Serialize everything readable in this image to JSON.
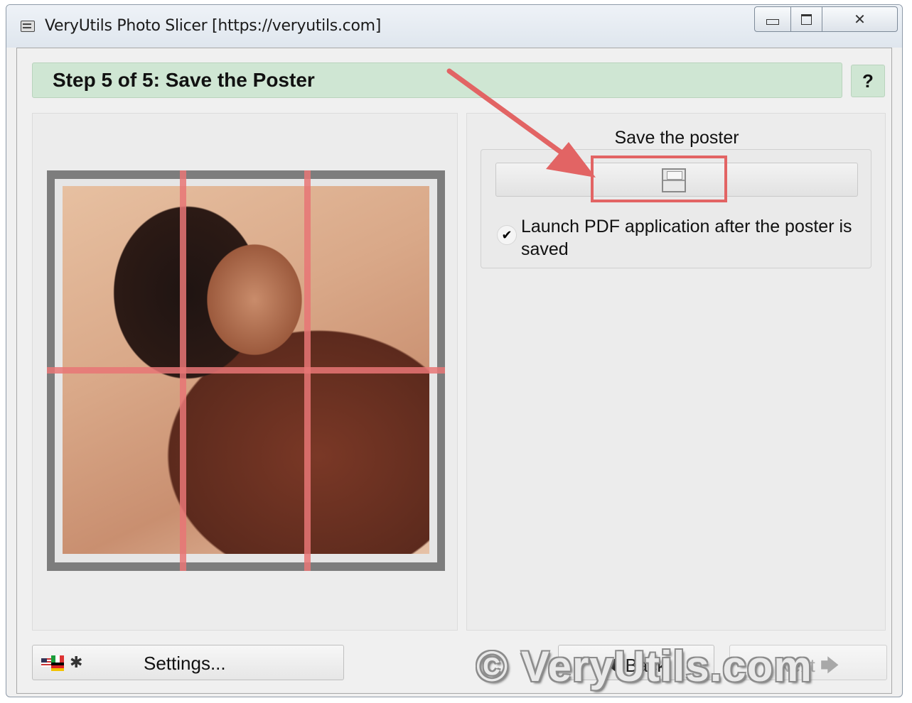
{
  "window": {
    "title": "VeryUtils Photo Slicer [https://veryutils.com]"
  },
  "header": {
    "step_title": "Step 5 of 5: Save the Poster",
    "help_label": "?"
  },
  "save_panel": {
    "label": "Save the poster",
    "launch_checkbox_checked": true,
    "checkmark": "✔",
    "launch_label": "Launch PDF application after the poster is saved"
  },
  "footer": {
    "settings_label": "Settings...",
    "back_label": "Back",
    "next_label": "Next",
    "back_arrow": "🡄",
    "next_arrow": "🡆"
  },
  "watermark": "© VeryUtils.com",
  "colors": {
    "header_green": "#cfe6d3",
    "highlight_red": "#e26464",
    "grid_red": "#e87676"
  },
  "icons": {
    "app": "app-icon",
    "save": "floppy-disk-icon",
    "settings": "flags-tools-icon"
  }
}
